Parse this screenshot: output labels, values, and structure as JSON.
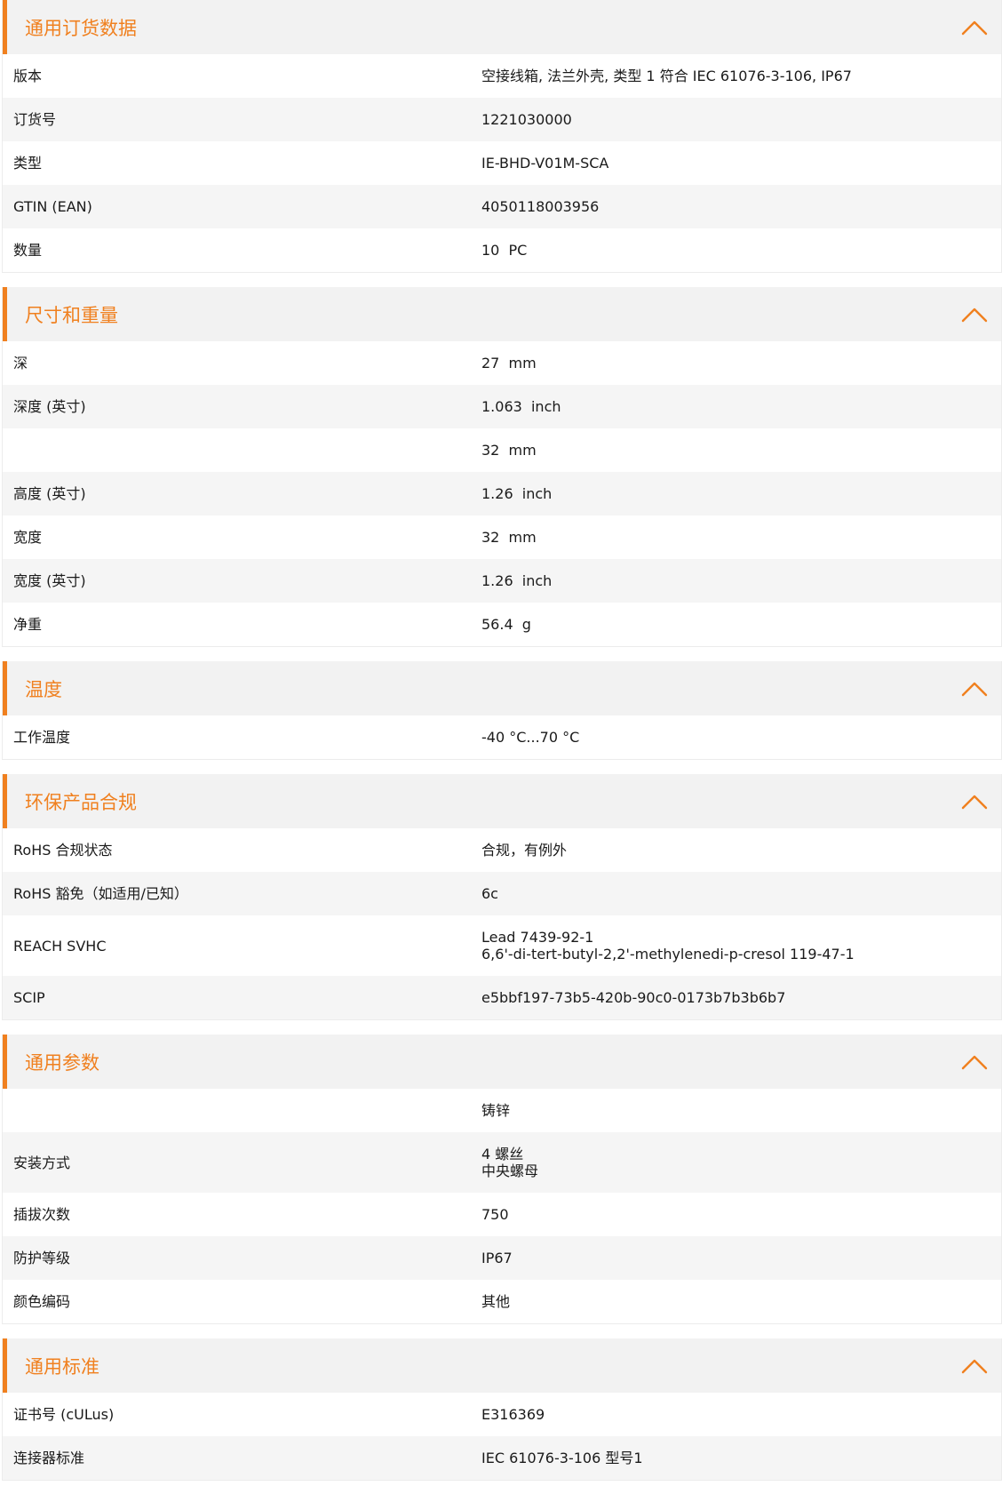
{
  "accent_color": "#f0801f",
  "collapse_icon": "chevron-up-icon",
  "sections": [
    {
      "title": "通用订货数据",
      "rows": [
        {
          "label": "版本",
          "value": [
            "空接线箱, 法兰外壳, 类型 1 符合 IEC 61076-3-106, IP67"
          ]
        },
        {
          "label": "订货号",
          "value": [
            "1221030000"
          ]
        },
        {
          "label": "类型",
          "value": [
            "IE-BHD-V01M-SCA"
          ]
        },
        {
          "label": "GTIN (EAN)",
          "value": [
            "4050118003956"
          ]
        },
        {
          "label": "数量",
          "value": [
            "10  PC"
          ]
        }
      ]
    },
    {
      "title": "尺寸和重量",
      "rows": [
        {
          "label": "深",
          "value": [
            "27  mm"
          ]
        },
        {
          "label": "深度 (英寸)",
          "value": [
            "1.063  inch"
          ]
        },
        {
          "label": "",
          "value": [
            "32  mm"
          ]
        },
        {
          "label": "高度 (英寸)",
          "value": [
            "1.26  inch"
          ]
        },
        {
          "label": "宽度",
          "value": [
            "32  mm"
          ]
        },
        {
          "label": "宽度 (英寸)",
          "value": [
            "1.26  inch"
          ]
        },
        {
          "label": "净重",
          "value": [
            "56.4  g"
          ]
        }
      ]
    },
    {
      "title": "温度",
      "rows": [
        {
          "label": "工作温度",
          "value": [
            "-40 °C...70 °C"
          ]
        }
      ]
    },
    {
      "title": "环保产品合规",
      "rows": [
        {
          "label": "RoHS 合规状态",
          "value": [
            "合规，有例外"
          ]
        },
        {
          "label": "RoHS 豁免（如适用/已知）",
          "value": [
            "6c"
          ]
        },
        {
          "label": "REACH SVHC",
          "value": [
            "Lead 7439-92-1",
            "6,6'-di-tert-butyl-2,2'-methylenedi-p-cresol 119-47-1"
          ]
        },
        {
          "label": "SCIP",
          "value": [
            "e5bbf197-73b5-420b-90c0-0173b7b3b6b7"
          ]
        }
      ]
    },
    {
      "title": "通用参数",
      "rows": [
        {
          "label": "",
          "value": [
            "铸锌"
          ]
        },
        {
          "label": "安装方式",
          "value": [
            "4 螺丝",
            "中央螺母"
          ]
        },
        {
          "label": "插拔次数",
          "value": [
            "750"
          ]
        },
        {
          "label": "防护等级",
          "value": [
            "IP67"
          ]
        },
        {
          "label": "颜色编码",
          "value": [
            "其他"
          ]
        }
      ]
    },
    {
      "title": "通用标准",
      "rows": [
        {
          "label": "证书号 (cULus)",
          "value": [
            "E316369"
          ]
        },
        {
          "label": "连接器标准",
          "value": [
            "IEC 61076-3-106 型号1"
          ]
        }
      ]
    }
  ]
}
